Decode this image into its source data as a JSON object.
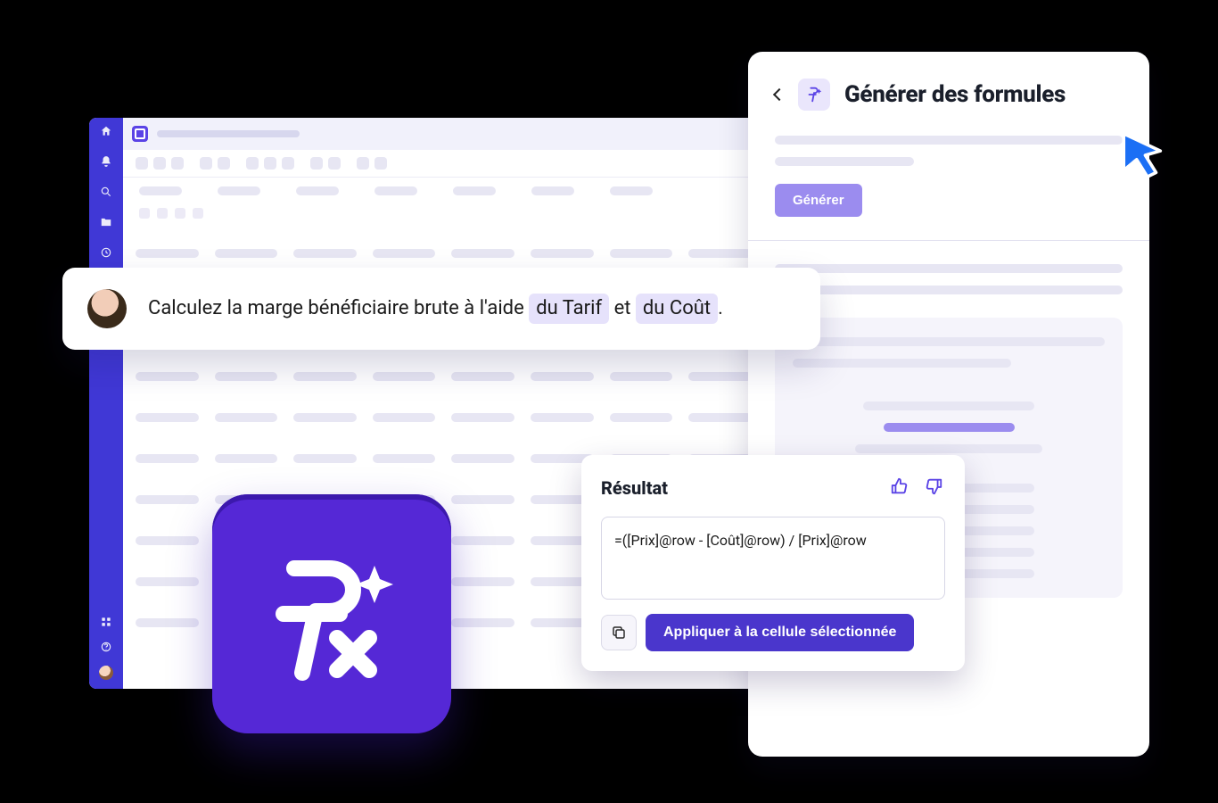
{
  "prompt": {
    "prefix": "Calculez la marge bénéficiaire brute à l'aide ",
    "mention1": "du Tarif",
    "middle": " et ",
    "mention2": "du Coût",
    "suffix": "."
  },
  "panel": {
    "title": "Générer des formules",
    "generate_label": "Générer"
  },
  "result": {
    "title": "Résultat",
    "formula": "=([Prix]@row - [Coût]@row) / [Prix]@row",
    "apply_label": "Appliquer à la cellule sélectionnée"
  },
  "icons": {
    "fx": "fx-sparkle-icon",
    "copy": "copy-icon",
    "thumbs_up": "thumbs-up-icon",
    "thumbs_down": "thumbs-down-icon"
  },
  "colors": {
    "primary": "#5528d6",
    "accent": "#4a36cc",
    "highlight": "#e6e2fb"
  }
}
